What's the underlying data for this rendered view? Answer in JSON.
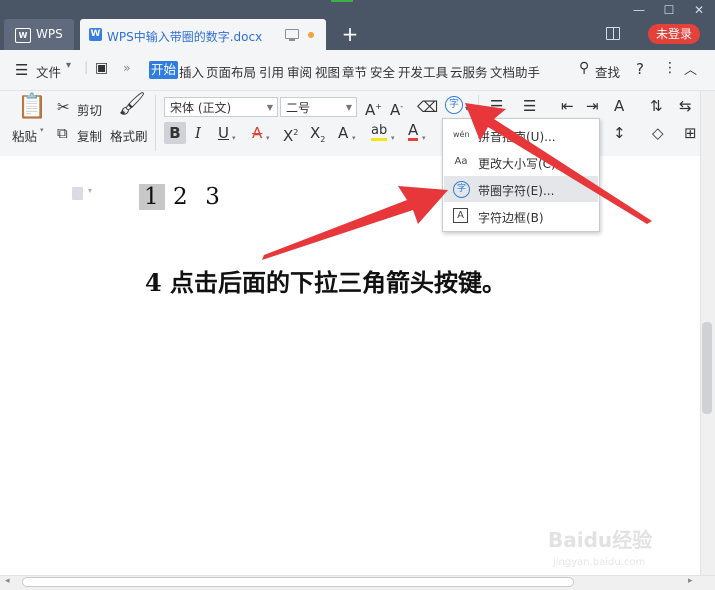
{
  "titlebar": {
    "app_tab_label": "WPS",
    "doc_tab_title": "WPS中输入带圈的数字.docx",
    "login_label": "未登录",
    "new_tab_symbol": "+"
  },
  "menubar": {
    "file_label": "文件",
    "items": [
      "开始",
      "插入",
      "页面布局",
      "引用",
      "审阅",
      "视图",
      "章节",
      "安全",
      "开发工具",
      "云服务",
      "文档助手"
    ],
    "find_label": "查找",
    "help_symbol": "?"
  },
  "ribbon": {
    "paste_label": "粘贴",
    "cut_label": "剪切",
    "copy_label": "复制",
    "format_painter_label": "格式刷",
    "font_name": "宋体 (正文)",
    "font_size": "二号",
    "enclose_char_glyph": "字"
  },
  "document": {
    "highlighted_char": "1",
    "rest_text": "2  3",
    "instruction": "4 点击后面的下拉三角箭头按键。"
  },
  "dropdown": {
    "items": [
      {
        "icon": "pinyin-guide-icon",
        "glyph": "wén",
        "label": "拼音指南(U)..."
      },
      {
        "icon": "change-case-icon",
        "glyph": "Aa",
        "label": "更改大小写(C)..."
      },
      {
        "icon": "enclose-char-icon",
        "glyph": "字",
        "label": "带圈字符(E)..."
      },
      {
        "icon": "char-border-icon",
        "glyph": "A",
        "label": "字符边框(B)"
      }
    ]
  },
  "watermark": {
    "text": "Baidu经验",
    "url": "jingyan.baidu.com"
  },
  "colors": {
    "accent": "#2f7de1",
    "titlebar": "#4a5566",
    "login": "#e2423a",
    "annotation_arrow": "#e8373a"
  }
}
